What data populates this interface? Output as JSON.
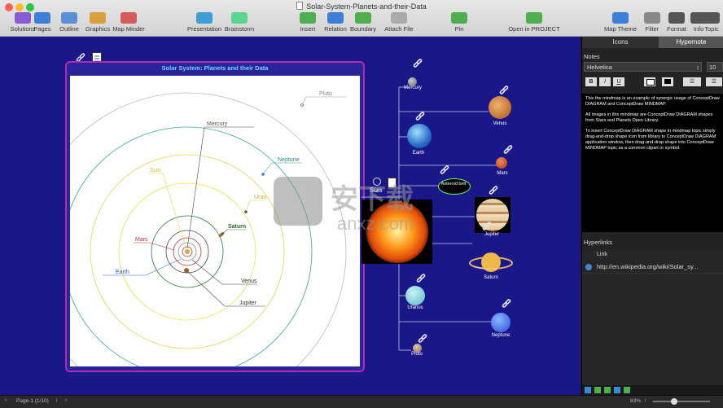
{
  "window": {
    "title": "Solar-System-Planets-and-their-Data"
  },
  "toolbar": [
    {
      "label": "Solutions",
      "color": "#8b5bd6"
    },
    {
      "label": "Pages",
      "color": "#3d7fd6"
    },
    {
      "label": "Outline",
      "color": "#5b8fd6"
    },
    {
      "label": "Graphics",
      "color": "#d6a13d"
    },
    {
      "label": "Map Minder",
      "color": "#d65b5b"
    },
    {
      "label": "Presentation",
      "color": "#3d9fd6"
    },
    {
      "label": "Brainstorm",
      "color": "#5bd68f"
    },
    {
      "label": "Insert",
      "color": "#4fae4f"
    },
    {
      "label": "Relation",
      "color": "#3d7fd6"
    },
    {
      "label": "Boundary",
      "color": "#4fae4f"
    },
    {
      "label": "Attach File",
      "color": "#aaaaaa"
    },
    {
      "label": "Pin",
      "color": "#4fae4f"
    },
    {
      "label": "Open in PROJECT",
      "color": "#4fae4f"
    },
    {
      "label": "Map Theme",
      "color": "#3d7fd6"
    },
    {
      "label": "Filter",
      "color": "#888888"
    },
    {
      "label": "Format",
      "color": "#555555"
    },
    {
      "label": "Info",
      "color": "#555555"
    },
    {
      "label": "Topic",
      "color": "#555555"
    }
  ],
  "diagram": {
    "title": "Solar System: Planets and their Data",
    "labels": {
      "pluto": "Pluto",
      "mercury": "Mercury",
      "neptune": "Neptune",
      "sun": "Sun",
      "uran": "Uran",
      "saturn": "Saturn",
      "mars": "Mars",
      "earth": "Earth",
      "venus": "Venus",
      "jupiter": "Jupiter"
    }
  },
  "mindmap": {
    "center": "Sun",
    "asteroid_belt": "Asteroid belt",
    "satellites": {
      "mercury": "Mercury",
      "venus": "Venus",
      "earth": "Earth",
      "mars": "Mars",
      "jupiter": "Jupiter",
      "saturn": "Saturn",
      "uranus": "Uranus",
      "neptune": "Neptune",
      "pluto": "Pluto"
    }
  },
  "sidebar": {
    "tabs": {
      "icons": "Icons",
      "hypernote": "Hypernote"
    },
    "notes_label": "Notes",
    "font_name": "Helvetica",
    "font_size": "10",
    "notes": [
      "This the mindmap is an example of synergic usage of ConceptDraw DIAGRAM and ConceptDraw MINDMAP.",
      "All images in this mindmap are ConceptDraw DIAGRAM shapes from Stars and Planets Open Library.",
      "To insert ConceptDraw DIAGRAM shape in mindmap topic simply drag-and-drop shape icon from library to ConceptDraw DIAGRAM application window, then drag-and-drop shape into ConceptDraw MINDMAP topic as a common clipart or symbol."
    ],
    "hyperlinks_label": "Hyperlinks",
    "link_header": "Link",
    "link": "http://en.wikipedia.org/wiki/Solar_sy..."
  },
  "statusbar": {
    "page": "Page-1 (1/10)",
    "zoom": "83%"
  },
  "watermark": {
    "text": "安下载",
    "sub": "anxz.com"
  }
}
